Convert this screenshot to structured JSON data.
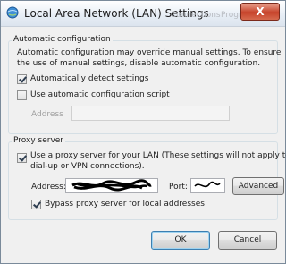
{
  "window": {
    "title": "Local Area Network (LAN) Settings",
    "close_label": "X",
    "background_tab_texts": [
      "Connections",
      "Programs"
    ]
  },
  "automatic_configuration": {
    "group_label": "Automatic configuration",
    "description": [
      "Automatic configuration may override manual settings.  To ensure",
      "the use of manual settings, disable automatic configuration."
    ],
    "auto_detect": {
      "label": "Automatically detect settings",
      "checked": true
    },
    "use_script": {
      "label": "Use automatic configuration script",
      "checked": false
    },
    "address_label": "Address",
    "address_value": ""
  },
  "proxy_server": {
    "group_label": "Proxy server",
    "use_proxy": {
      "label_lines": [
        "Use a proxy server for your LAN (These settings will not apply to",
        "dial-up or VPN connections)."
      ],
      "checked": true
    },
    "address_label": "Address:",
    "port_label": "Port:",
    "advanced_label": "Advanced",
    "bypass_local": {
      "label": "Bypass proxy server for local addresses",
      "checked": true
    }
  },
  "buttons": {
    "ok": "OK",
    "cancel": "Cancel"
  }
}
